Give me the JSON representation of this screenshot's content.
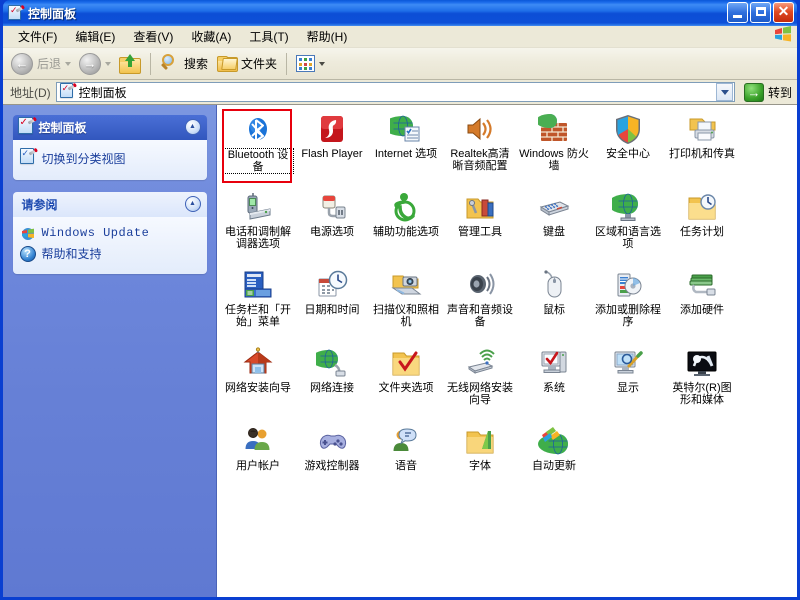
{
  "window": {
    "title": "控制面板",
    "icon": "control-panel-icon",
    "buttons": {
      "minimize": "_",
      "maximize": "□",
      "close": "✕"
    }
  },
  "menu": [
    {
      "label": "文件(F)"
    },
    {
      "label": "编辑(E)"
    },
    {
      "label": "查看(V)"
    },
    {
      "label": "收藏(A)"
    },
    {
      "label": "工具(T)"
    },
    {
      "label": "帮助(H)"
    }
  ],
  "toolbar": {
    "back": "后退",
    "forward": "",
    "up": "",
    "search": "搜索",
    "folders": "文件夹",
    "views": ""
  },
  "address": {
    "label": "地址(D)",
    "value": "控制面板",
    "go": "转到"
  },
  "sidebar": {
    "panels": [
      {
        "title": "控制面板",
        "style": "dark",
        "items": [
          {
            "label": "切换到分类视图",
            "icon": "control-panel-icon"
          }
        ]
      },
      {
        "title": "请参阅",
        "style": "light",
        "items": [
          {
            "label": "Windows Update",
            "icon": "windows-update-icon"
          },
          {
            "label": "帮助和支持",
            "icon": "help-icon"
          }
        ]
      }
    ]
  },
  "content": {
    "selected_index": 0,
    "highlight_color": "#e8000d",
    "items": [
      {
        "label": "Bluetooth 设备",
        "icon": "bluetooth-icon"
      },
      {
        "label": "Flash Player",
        "icon": "flash-player-icon"
      },
      {
        "label": "Internet 选项",
        "icon": "internet-options-icon"
      },
      {
        "label": "Realtek高清晰音频配置",
        "icon": "realtek-audio-icon"
      },
      {
        "label": "Windows 防火墙",
        "icon": "firewall-icon"
      },
      {
        "label": "安全中心",
        "icon": "security-center-icon"
      },
      {
        "label": "打印机和传真",
        "icon": "printers-faxes-icon"
      },
      {
        "label": "电话和调制解调器选项",
        "icon": "phone-modem-icon"
      },
      {
        "label": "电源选项",
        "icon": "power-options-icon"
      },
      {
        "label": "辅助功能选项",
        "icon": "accessibility-icon"
      },
      {
        "label": "管理工具",
        "icon": "admin-tools-icon"
      },
      {
        "label": "键盘",
        "icon": "keyboard-icon"
      },
      {
        "label": "区域和语言选项",
        "icon": "regional-language-icon"
      },
      {
        "label": "任务计划",
        "icon": "scheduled-tasks-icon"
      },
      {
        "label": "任务栏和「开始」菜单",
        "icon": "taskbar-startmenu-icon"
      },
      {
        "label": "日期和时间",
        "icon": "date-time-icon"
      },
      {
        "label": "扫描仪和照相机",
        "icon": "scanners-cameras-icon"
      },
      {
        "label": "声音和音频设备",
        "icon": "sounds-audio-icon"
      },
      {
        "label": "鼠标",
        "icon": "mouse-icon"
      },
      {
        "label": "添加或删除程序",
        "icon": "add-remove-programs-icon"
      },
      {
        "label": "添加硬件",
        "icon": "add-hardware-icon"
      },
      {
        "label": "网络安装向导",
        "icon": "network-setup-wizard-icon"
      },
      {
        "label": "网络连接",
        "icon": "network-connections-icon"
      },
      {
        "label": "文件夹选项",
        "icon": "folder-options-icon"
      },
      {
        "label": "无线网络安装向导",
        "icon": "wireless-network-wizard-icon"
      },
      {
        "label": "系统",
        "icon": "system-icon"
      },
      {
        "label": "显示",
        "icon": "display-icon"
      },
      {
        "label": "英特尔(R)图形和媒体",
        "icon": "intel-graphics-icon"
      },
      {
        "label": "用户帐户",
        "icon": "user-accounts-icon"
      },
      {
        "label": "游戏控制器",
        "icon": "game-controllers-icon"
      },
      {
        "label": "语音",
        "icon": "speech-icon"
      },
      {
        "label": "字体",
        "icon": "fonts-icon"
      },
      {
        "label": "自动更新",
        "icon": "automatic-updates-icon"
      }
    ]
  }
}
